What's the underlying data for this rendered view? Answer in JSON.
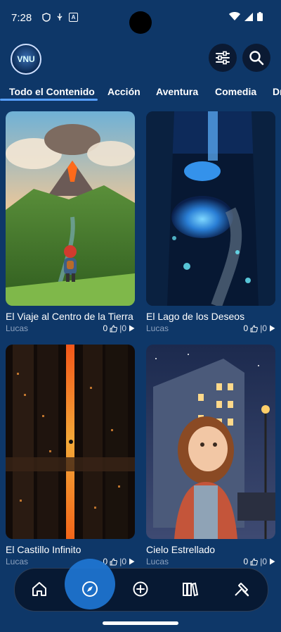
{
  "status_bar": {
    "time": "7:28",
    "a_badge": "A"
  },
  "header": {
    "logo_text": "VNU"
  },
  "tabs": [
    {
      "label": "Todo el Contenido",
      "active": true
    },
    {
      "label": "Acción"
    },
    {
      "label": "Aventura"
    },
    {
      "label": "Comedia"
    },
    {
      "label": "Dr"
    }
  ],
  "cards": [
    {
      "title": "El Viaje al Centro de la Tierra",
      "author": "Lucas",
      "likes": "0",
      "plays": "|0",
      "image": "volcano-landscape"
    },
    {
      "title": "El Lago de los Deseos",
      "author": "Lucas",
      "likes": "0",
      "plays": "|0",
      "image": "glowing-blue-lake"
    },
    {
      "title": "El Castillo Infinito",
      "author": "Lucas",
      "likes": "0",
      "plays": "|0",
      "image": "infinite-city"
    },
    {
      "title": "Cielo Estrellado",
      "author": "Lucas",
      "likes": "0",
      "plays": "|0",
      "image": "girl-night-sky"
    }
  ],
  "nav": {
    "items": [
      "home-icon",
      "compass-icon",
      "add-icon",
      "library-icon",
      "tools-icon"
    ],
    "active": "compass-icon",
    "accent": "#1f78d6"
  },
  "colors": {
    "background": "#0e3768",
    "tab_underline": "#58a0ff"
  }
}
